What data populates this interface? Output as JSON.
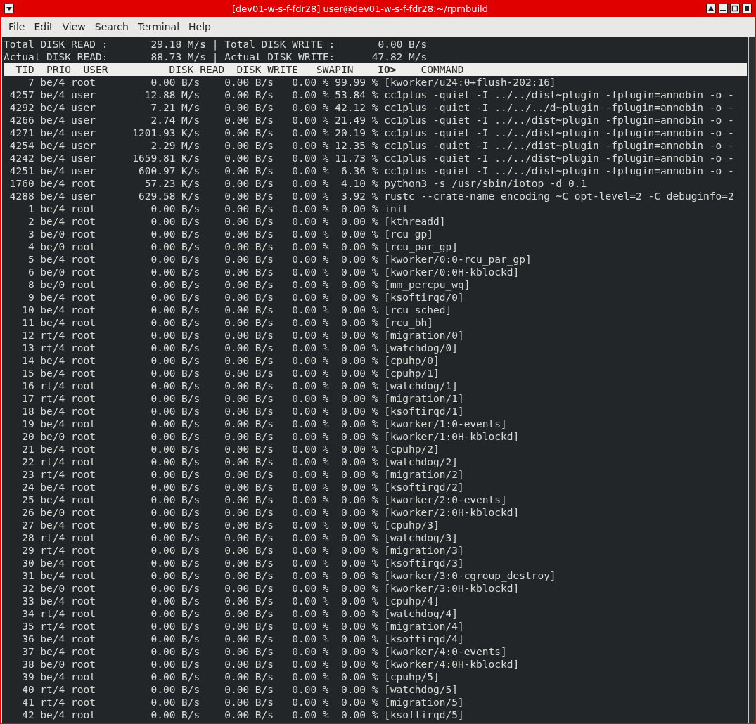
{
  "window": {
    "title": "[dev01-w-s-f-fdr28] user@dev01-w-s-f-fdr28:~/rpmbuild"
  },
  "menu": [
    "File",
    "Edit",
    "View",
    "Search",
    "Terminal",
    "Help"
  ],
  "summary": [
    {
      "separator": "|",
      "items": [
        {
          "label": "Total DISK READ :",
          "value": "29.18 M/s"
        },
        {
          "label": "Total DISK WRITE :",
          "value": "0.00 B/s"
        }
      ]
    },
    {
      "separator": "|",
      "items": [
        {
          "label": "Actual DISK READ:",
          "value": "88.73 M/s"
        },
        {
          "label": "Actual DISK WRITE:",
          "value": "47.82 M/s"
        }
      ]
    }
  ],
  "columns": [
    {
      "label": "TID",
      "sorted": false
    },
    {
      "label": "PRIO",
      "sorted": false
    },
    {
      "label": "USER",
      "sorted": false
    },
    {
      "label": "DISK READ",
      "sorted": false
    },
    {
      "label": "DISK WRITE",
      "sorted": false
    },
    {
      "label": "SWAPIN",
      "sorted": false
    },
    {
      "label": "IO>",
      "sorted": true
    },
    {
      "label": "COMMAND",
      "sorted": false
    }
  ],
  "rows": [
    [
      "7",
      "be/4",
      "root",
      "0.00 B/s",
      "0.00 B/s",
      "0.00 %",
      "99.99 %",
      "[kworker/u24:0+flush-202:16]"
    ],
    [
      "4257",
      "be/4",
      "user",
      "12.88 M/s",
      "0.00 B/s",
      "0.00 %",
      "53.84 %",
      "cc1plus -quiet -I ../../dist~plugin -fplugin=annobin -o -"
    ],
    [
      "4292",
      "be/4",
      "user",
      "7.21 M/s",
      "0.00 B/s",
      "0.00 %",
      "42.12 %",
      "cc1plus -quiet -I ../../../d~plugin -fplugin=annobin -o -"
    ],
    [
      "4266",
      "be/4",
      "user",
      "2.74 M/s",
      "0.00 B/s",
      "0.00 %",
      "21.49 %",
      "cc1plus -quiet -I ../../dist~plugin -fplugin=annobin -o -"
    ],
    [
      "4271",
      "be/4",
      "user",
      "1201.93 K/s",
      "0.00 B/s",
      "0.00 %",
      "20.19 %",
      "cc1plus -quiet -I ../../dist~plugin -fplugin=annobin -o -"
    ],
    [
      "4254",
      "be/4",
      "user",
      "2.29 M/s",
      "0.00 B/s",
      "0.00 %",
      "12.35 %",
      "cc1plus -quiet -I ../../dist~plugin -fplugin=annobin -o -"
    ],
    [
      "4242",
      "be/4",
      "user",
      "1659.81 K/s",
      "0.00 B/s",
      "0.00 %",
      "11.73 %",
      "cc1plus -quiet -I ../../dist~plugin -fplugin=annobin -o -"
    ],
    [
      "4251",
      "be/4",
      "user",
      "600.97 K/s",
      "0.00 B/s",
      "0.00 %",
      "6.36 %",
      "cc1plus -quiet -I ../../dist~plugin -fplugin=annobin -o -"
    ],
    [
      "1760",
      "be/4",
      "root",
      "57.23 K/s",
      "0.00 B/s",
      "0.00 %",
      "4.10 %",
      "python3 -s /usr/sbin/iotop -d 0.1"
    ],
    [
      "4288",
      "be/4",
      "user",
      "629.58 K/s",
      "0.00 B/s",
      "0.00 %",
      "3.92 %",
      "rustc --crate-name encoding_~C opt-level=2 -C debuginfo=2"
    ],
    [
      "1",
      "be/4",
      "root",
      "0.00 B/s",
      "0.00 B/s",
      "0.00 %",
      "0.00 %",
      "init"
    ],
    [
      "2",
      "be/4",
      "root",
      "0.00 B/s",
      "0.00 B/s",
      "0.00 %",
      "0.00 %",
      "[kthreadd]"
    ],
    [
      "3",
      "be/0",
      "root",
      "0.00 B/s",
      "0.00 B/s",
      "0.00 %",
      "0.00 %",
      "[rcu_gp]"
    ],
    [
      "4",
      "be/0",
      "root",
      "0.00 B/s",
      "0.00 B/s",
      "0.00 %",
      "0.00 %",
      "[rcu_par_gp]"
    ],
    [
      "5",
      "be/4",
      "root",
      "0.00 B/s",
      "0.00 B/s",
      "0.00 %",
      "0.00 %",
      "[kworker/0:0-rcu_par_gp]"
    ],
    [
      "6",
      "be/0",
      "root",
      "0.00 B/s",
      "0.00 B/s",
      "0.00 %",
      "0.00 %",
      "[kworker/0:0H-kblockd]"
    ],
    [
      "8",
      "be/0",
      "root",
      "0.00 B/s",
      "0.00 B/s",
      "0.00 %",
      "0.00 %",
      "[mm_percpu_wq]"
    ],
    [
      "9",
      "be/4",
      "root",
      "0.00 B/s",
      "0.00 B/s",
      "0.00 %",
      "0.00 %",
      "[ksoftirqd/0]"
    ],
    [
      "10",
      "be/4",
      "root",
      "0.00 B/s",
      "0.00 B/s",
      "0.00 %",
      "0.00 %",
      "[rcu_sched]"
    ],
    [
      "11",
      "be/4",
      "root",
      "0.00 B/s",
      "0.00 B/s",
      "0.00 %",
      "0.00 %",
      "[rcu_bh]"
    ],
    [
      "12",
      "rt/4",
      "root",
      "0.00 B/s",
      "0.00 B/s",
      "0.00 %",
      "0.00 %",
      "[migration/0]"
    ],
    [
      "13",
      "rt/4",
      "root",
      "0.00 B/s",
      "0.00 B/s",
      "0.00 %",
      "0.00 %",
      "[watchdog/0]"
    ],
    [
      "14",
      "be/4",
      "root",
      "0.00 B/s",
      "0.00 B/s",
      "0.00 %",
      "0.00 %",
      "[cpuhp/0]"
    ],
    [
      "15",
      "be/4",
      "root",
      "0.00 B/s",
      "0.00 B/s",
      "0.00 %",
      "0.00 %",
      "[cpuhp/1]"
    ],
    [
      "16",
      "rt/4",
      "root",
      "0.00 B/s",
      "0.00 B/s",
      "0.00 %",
      "0.00 %",
      "[watchdog/1]"
    ],
    [
      "17",
      "rt/4",
      "root",
      "0.00 B/s",
      "0.00 B/s",
      "0.00 %",
      "0.00 %",
      "[migration/1]"
    ],
    [
      "18",
      "be/4",
      "root",
      "0.00 B/s",
      "0.00 B/s",
      "0.00 %",
      "0.00 %",
      "[ksoftirqd/1]"
    ],
    [
      "19",
      "be/4",
      "root",
      "0.00 B/s",
      "0.00 B/s",
      "0.00 %",
      "0.00 %",
      "[kworker/1:0-events]"
    ],
    [
      "20",
      "be/0",
      "root",
      "0.00 B/s",
      "0.00 B/s",
      "0.00 %",
      "0.00 %",
      "[kworker/1:0H-kblockd]"
    ],
    [
      "21",
      "be/4",
      "root",
      "0.00 B/s",
      "0.00 B/s",
      "0.00 %",
      "0.00 %",
      "[cpuhp/2]"
    ],
    [
      "22",
      "rt/4",
      "root",
      "0.00 B/s",
      "0.00 B/s",
      "0.00 %",
      "0.00 %",
      "[watchdog/2]"
    ],
    [
      "23",
      "rt/4",
      "root",
      "0.00 B/s",
      "0.00 B/s",
      "0.00 %",
      "0.00 %",
      "[migration/2]"
    ],
    [
      "24",
      "be/4",
      "root",
      "0.00 B/s",
      "0.00 B/s",
      "0.00 %",
      "0.00 %",
      "[ksoftirqd/2]"
    ],
    [
      "25",
      "be/4",
      "root",
      "0.00 B/s",
      "0.00 B/s",
      "0.00 %",
      "0.00 %",
      "[kworker/2:0-events]"
    ],
    [
      "26",
      "be/0",
      "root",
      "0.00 B/s",
      "0.00 B/s",
      "0.00 %",
      "0.00 %",
      "[kworker/2:0H-kblockd]"
    ],
    [
      "27",
      "be/4",
      "root",
      "0.00 B/s",
      "0.00 B/s",
      "0.00 %",
      "0.00 %",
      "[cpuhp/3]"
    ],
    [
      "28",
      "rt/4",
      "root",
      "0.00 B/s",
      "0.00 B/s",
      "0.00 %",
      "0.00 %",
      "[watchdog/3]"
    ],
    [
      "29",
      "rt/4",
      "root",
      "0.00 B/s",
      "0.00 B/s",
      "0.00 %",
      "0.00 %",
      "[migration/3]"
    ],
    [
      "30",
      "be/4",
      "root",
      "0.00 B/s",
      "0.00 B/s",
      "0.00 %",
      "0.00 %",
      "[ksoftirqd/3]"
    ],
    [
      "31",
      "be/4",
      "root",
      "0.00 B/s",
      "0.00 B/s",
      "0.00 %",
      "0.00 %",
      "[kworker/3:0-cgroup_destroy]"
    ],
    [
      "32",
      "be/0",
      "root",
      "0.00 B/s",
      "0.00 B/s",
      "0.00 %",
      "0.00 %",
      "[kworker/3:0H-kblockd]"
    ],
    [
      "33",
      "be/4",
      "root",
      "0.00 B/s",
      "0.00 B/s",
      "0.00 %",
      "0.00 %",
      "[cpuhp/4]"
    ],
    [
      "34",
      "rt/4",
      "root",
      "0.00 B/s",
      "0.00 B/s",
      "0.00 %",
      "0.00 %",
      "[watchdog/4]"
    ],
    [
      "35",
      "rt/4",
      "root",
      "0.00 B/s",
      "0.00 B/s",
      "0.00 %",
      "0.00 %",
      "[migration/4]"
    ],
    [
      "36",
      "be/4",
      "root",
      "0.00 B/s",
      "0.00 B/s",
      "0.00 %",
      "0.00 %",
      "[ksoftirqd/4]"
    ],
    [
      "37",
      "be/4",
      "root",
      "0.00 B/s",
      "0.00 B/s",
      "0.00 %",
      "0.00 %",
      "[kworker/4:0-events]"
    ],
    [
      "38",
      "be/0",
      "root",
      "0.00 B/s",
      "0.00 B/s",
      "0.00 %",
      "0.00 %",
      "[kworker/4:0H-kblockd]"
    ],
    [
      "39",
      "be/4",
      "root",
      "0.00 B/s",
      "0.00 B/s",
      "0.00 %",
      "0.00 %",
      "[cpuhp/5]"
    ],
    [
      "40",
      "rt/4",
      "root",
      "0.00 B/s",
      "0.00 B/s",
      "0.00 %",
      "0.00 %",
      "[watchdog/5]"
    ],
    [
      "41",
      "rt/4",
      "root",
      "0.00 B/s",
      "0.00 B/s",
      "0.00 %",
      "0.00 %",
      "[migration/5]"
    ],
    [
      "42",
      "be/4",
      "root",
      "0.00 B/s",
      "0.00 B/s",
      "0.00 %",
      "0.00 %",
      "[ksoftirqd/5]"
    ]
  ]
}
